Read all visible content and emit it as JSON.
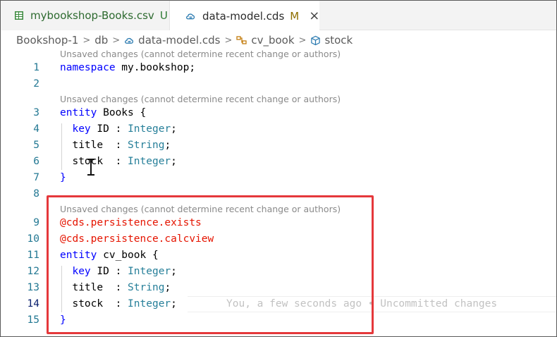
{
  "tabs": [
    {
      "label": "mybookshop-Books.csv",
      "status": "U",
      "icon": "table-icon"
    },
    {
      "label": "data-model.cds",
      "status": "M",
      "icon": "cds-file-icon",
      "close": "×"
    }
  ],
  "breadcrumb": {
    "items": [
      "Bookshop-1",
      "db",
      "data-model.cds",
      "cv_book",
      "stock"
    ],
    "separator": ">"
  },
  "editor": {
    "codelens": "Unsaved changes (cannot determine recent change or authors)",
    "lines": {
      "n1": "1",
      "n2": "2",
      "n3": "3",
      "n4": "4",
      "n5": "5",
      "n6": "6",
      "n7": "7",
      "n8": "8",
      "n9": "9",
      "n10": "10",
      "n11": "11",
      "n12": "12",
      "n13": "13",
      "n14": "14",
      "n15": "15"
    },
    "code": {
      "ns_kw": "namespace",
      "ns_name": " my.bookshop;",
      "entity_kw": "entity",
      "books_name": " Books {",
      "key_kw": "key",
      "id_field": " ID : ",
      "integer": "Integer",
      "semicolon": ";",
      "title_field": "title  : ",
      "string": "String",
      "stock_field": "stock  : ",
      "close_brace": "}",
      "anno1": "@cds.persistence.exists",
      "anno2": "@cds.persistence.calcview",
      "cvbook_name": " cv_book {"
    },
    "blame": "You, a few seconds ago • Uncommitted changes"
  },
  "colors": {
    "keyword": "#0000ff",
    "type": "#267f99",
    "annotation": "#e51400",
    "line_number": "#237893",
    "highlight": "#e5383b",
    "modified": "#8e6f00",
    "untracked": "#2d7a33"
  }
}
